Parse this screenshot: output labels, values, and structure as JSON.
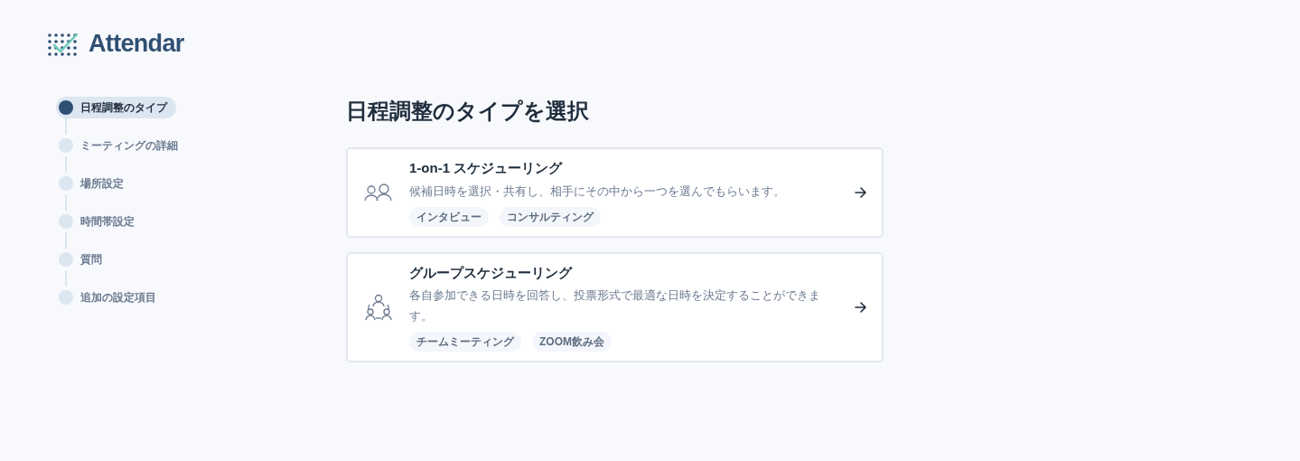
{
  "logo": {
    "name": "Attendar"
  },
  "steps": [
    {
      "label": "日程調整のタイプ",
      "selected": true
    },
    {
      "label": "ミーティングの詳細",
      "selected": false
    },
    {
      "label": "場所設定",
      "selected": false
    },
    {
      "label": "時間帯設定",
      "selected": false
    },
    {
      "label": "質問",
      "selected": false
    },
    {
      "label": "追加の設定項目",
      "selected": false
    }
  ],
  "heading": "日程調整のタイプを選択",
  "options": [
    {
      "kind": "pair",
      "title": "1-on-1 スケジューリング",
      "description": "候補日時を選択・共有し、相手にその中から一つを選んでもらいます。",
      "tags": [
        "インタビュー",
        "コンサルティング"
      ]
    },
    {
      "kind": "group",
      "title": "グループスケジューリング",
      "description": "各自参加できる日時を回答し、投票形式で最適な日時を決定することができます。",
      "tags": [
        "チームミーティング",
        "ZOOM飲み会"
      ]
    }
  ]
}
